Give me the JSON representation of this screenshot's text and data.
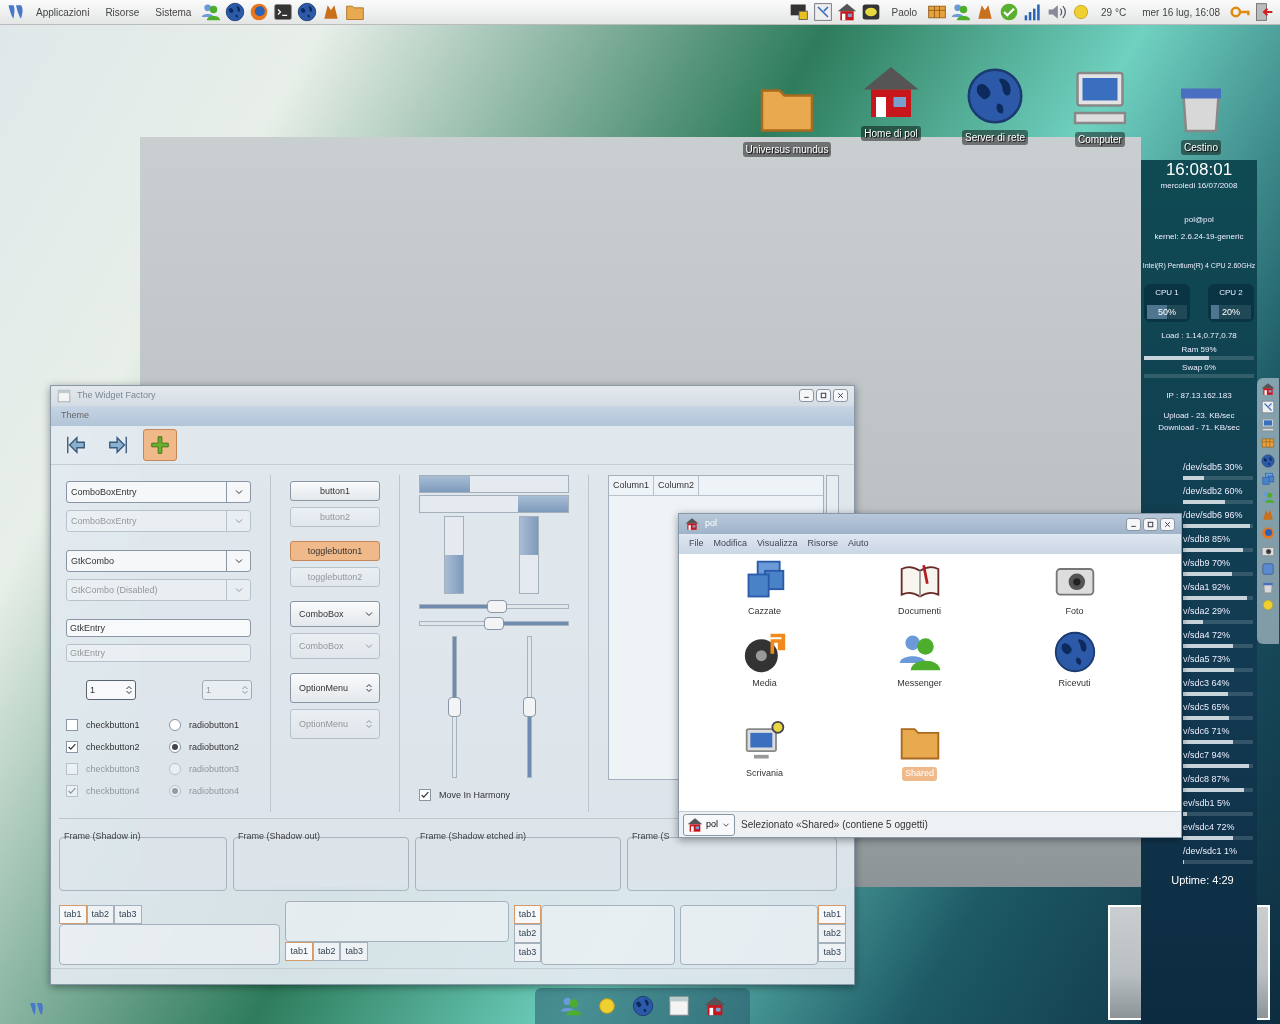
{
  "top_panel": {
    "menus": [
      "Applicazioni",
      "Risorse",
      "Sistema"
    ],
    "user": "Paolo",
    "temperature": "29 °C",
    "clock": "mer 16 lug, 16:08"
  },
  "desktop_icons": [
    {
      "label": "Universus mundus",
      "kind": "folder"
    },
    {
      "label": "Home di pol",
      "kind": "home"
    },
    {
      "label": "Server di rete",
      "kind": "globe"
    },
    {
      "label": "Computer",
      "kind": "computer"
    },
    {
      "label": "Cestino",
      "kind": "trash"
    }
  ],
  "conky": {
    "time": "16:08:01",
    "date": "mercoledi 16/07/2008",
    "user": "pol@pol",
    "kernel": "kernel: 2.6.24-19-generic",
    "cpu_model": "Intel(R) Pentium(R) 4 CPU 2.60GHz",
    "cpus": [
      {
        "label": "CPU 1",
        "reading": "50%",
        "level": 0.5
      },
      {
        "label": "CPU 2",
        "reading": "20%",
        "level": 0.2
      }
    ],
    "load": "Load : 1.14,0.77,0.78",
    "memory": [
      {
        "label": "Ram 59%",
        "level": 0.59
      },
      {
        "label": "Swap 0%",
        "level": 0
      }
    ],
    "ip": "IP : 87.13.162.183",
    "upload": "Upload - 23. KB/sec",
    "download": "Download - 71. KB/sec",
    "disks": [
      {
        "label": "/dev/sdb5 30%",
        "level": 0.3
      },
      {
        "label": "/dev/sdb2 60%",
        "level": 0.6
      },
      {
        "label": "/dev/sdb6 96%",
        "level": 0.96
      },
      {
        "label": "v/sdb8 85%",
        "level": 0.85
      },
      {
        "label": "v/sdb9 70%",
        "level": 0.7
      },
      {
        "label": "v/sda1 92%",
        "level": 0.92
      },
      {
        "label": "v/sda2 29%",
        "level": 0.29
      },
      {
        "label": "v/sda4 72%",
        "level": 0.72
      },
      {
        "label": "v/sda5 73%",
        "level": 0.73
      },
      {
        "label": "v/sdc3 64%",
        "level": 0.64
      },
      {
        "label": "v/sdc5 65%",
        "level": 0.65
      },
      {
        "label": "v/sdc6 71%",
        "level": 0.71
      },
      {
        "label": "v/sdc7 94%",
        "level": 0.94
      },
      {
        "label": "v/sdc8 87%",
        "level": 0.87
      },
      {
        "label": "ev/sdb1 5%",
        "level": 0.05
      },
      {
        "label": "ev/sdc4 72%",
        "level": 0.72
      },
      {
        "label": "/dev/sdc1 1%",
        "level": 0.01
      }
    ],
    "uptime": "Uptime: 4:29"
  },
  "widget_factory": {
    "title": "The Widget Factory",
    "menu": [
      "Theme"
    ],
    "combos": [
      {
        "kind": "combo",
        "text": "ComboBoxEntry",
        "disabled": false
      },
      {
        "kind": "combo",
        "text": "ComboBoxEntry",
        "disabled": true
      },
      {
        "kind": "combo",
        "text": "GtkCombo",
        "disabled": false
      },
      {
        "kind": "combo",
        "text": "GtkCombo (Disabled)",
        "disabled": true
      },
      {
        "kind": "entry",
        "text": "GtkEntry",
        "disabled": false
      },
      {
        "kind": "entry",
        "text": "GtkEntry",
        "disabled": true
      }
    ],
    "spins": [
      {
        "value": "1",
        "disabled": false
      },
      {
        "value": "1",
        "disabled": true
      }
    ],
    "checks": [
      {
        "label": "checkbutton1",
        "checked": false,
        "disabled": false
      },
      {
        "label": "checkbutton2",
        "checked": true,
        "disabled": false
      },
      {
        "label": "checkbutton3",
        "checked": false,
        "disabled": true
      },
      {
        "label": "checkbutton4",
        "checked": true,
        "disabled": true
      }
    ],
    "radios": [
      {
        "label": "radiobutton1",
        "selected": false,
        "disabled": false
      },
      {
        "label": "radiobutton2",
        "selected": true,
        "disabled": false
      },
      {
        "label": "radiobutton3",
        "selected": false,
        "disabled": true
      },
      {
        "label": "radiobutton4",
        "selected": true,
        "disabled": true
      }
    ],
    "buttons": [
      {
        "kind": "button",
        "text": "button1",
        "disabled": false,
        "on": false
      },
      {
        "kind": "button",
        "text": "button2",
        "disabled": true,
        "on": false
      },
      {
        "kind": "toggle",
        "text": "togglebutton1",
        "disabled": false,
        "on": true
      },
      {
        "kind": "toggle",
        "text": "togglebutton2",
        "disabled": true,
        "on": false
      },
      {
        "kind": "combobox",
        "text": "ComboBox",
        "disabled": false,
        "on": false
      },
      {
        "kind": "combobox",
        "text": "ComboBox",
        "disabled": true,
        "on": false
      },
      {
        "kind": "optionmenu",
        "text": "OptionMenu",
        "disabled": false,
        "on": false
      },
      {
        "kind": "optionmenu",
        "text": "OptionMenu",
        "disabled": true,
        "on": false
      }
    ],
    "progress_h": [
      {
        "level": 0.34,
        "inverted": false
      },
      {
        "level": 0.34,
        "inverted": true
      }
    ],
    "progress_v": [
      {
        "level": 0.5,
        "inverted": false
      },
      {
        "level": 0.5,
        "inverted": true
      }
    ],
    "scales_h": [
      {
        "level": 0.52,
        "inverted": false
      },
      {
        "level": 0.5,
        "inverted": true
      }
    ],
    "scales_v": [
      {
        "level": 0.5,
        "inverted": false
      },
      {
        "level": 0.5,
        "inverted": true
      }
    ],
    "harmony": {
      "label": "Move In Harmony",
      "checked": true
    },
    "tree_columns": [
      "Column1",
      "Column2"
    ],
    "frames": [
      "Frame (Shadow in)",
      "Frame (Shadow out)",
      "Frame (Shadow etched in)",
      "Frame (S"
    ],
    "notebooks": [
      {
        "kind": "top",
        "tabs": [
          {
            "label": "tab1",
            "selected": true
          },
          {
            "label": "tab2",
            "selected": false
          },
          {
            "label": "tab3",
            "selected": false
          }
        ]
      },
      {
        "kind": "bottom",
        "tabs": [
          {
            "label": "tab1",
            "selected": true
          },
          {
            "label": "tab2",
            "selected": false
          },
          {
            "label": "tab3",
            "selected": false
          }
        ]
      },
      {
        "kind": "left",
        "tabs": [
          {
            "label": "tab1",
            "selected": true
          },
          {
            "label": "tab2",
            "selected": false
          },
          {
            "label": "tab3",
            "selected": false
          }
        ]
      },
      {
        "kind": "right",
        "tabs": [
          {
            "label": "tab1",
            "selected": true
          },
          {
            "label": "tab2",
            "selected": false
          },
          {
            "label": "tab3",
            "selected": false
          }
        ]
      }
    ]
  },
  "file_manager": {
    "title": "pol",
    "menu": [
      "File",
      "Modifica",
      "Visualizza",
      "Risorse",
      "Aiuto"
    ],
    "items": [
      {
        "label": "Cazzate",
        "kind": "windows",
        "selected": false
      },
      {
        "label": "Documenti",
        "kind": "book",
        "selected": false
      },
      {
        "label": "Foto",
        "kind": "camera",
        "selected": false
      },
      {
        "label": "Media",
        "kind": "speaker",
        "selected": false
      },
      {
        "label": "Messenger",
        "kind": "people",
        "selected": false
      },
      {
        "label": "Ricevuti",
        "kind": "globe",
        "selected": false
      },
      {
        "label": "Scrivania",
        "kind": "monitor",
        "selected": false
      },
      {
        "label": "Shared",
        "kind": "folder",
        "selected": true
      }
    ],
    "location": "pol",
    "status": "Selezionato «Shared» (contiene 5 oggetti)"
  }
}
